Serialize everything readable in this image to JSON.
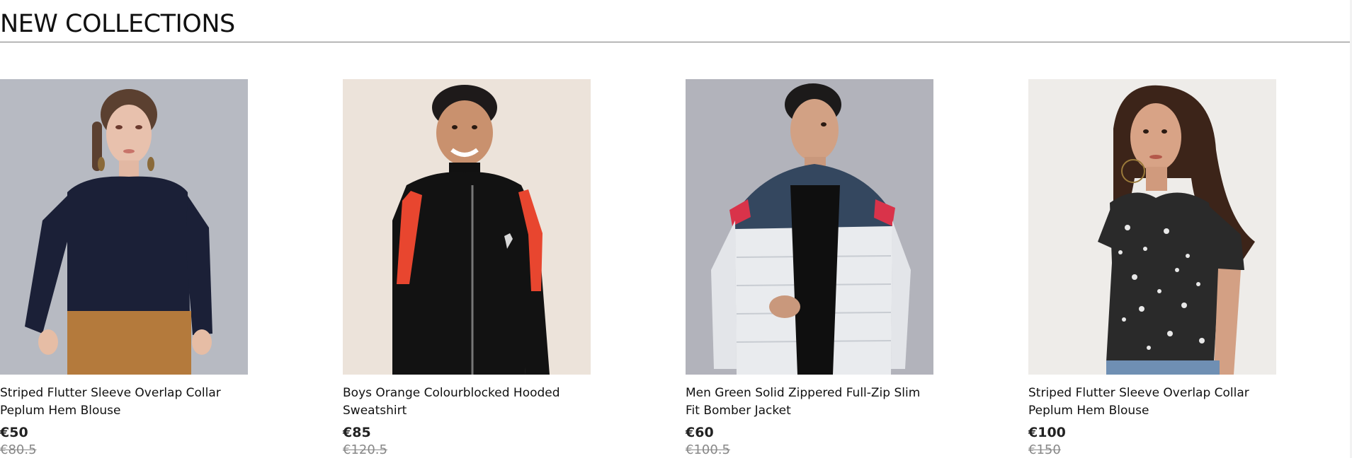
{
  "section": {
    "title": "NEW COLLECTIONS"
  },
  "products": [
    {
      "name": "Striped Flutter Sleeve Overlap Collar Peplum Hem Blouse",
      "price": "€50",
      "old_price": "€80.5",
      "image_bg": "#b7bac2",
      "image_icon": "woman-navy-sweater-photo"
    },
    {
      "name": "Boys Orange Colourblocked Hooded Sweatshirt",
      "price": "€85",
      "old_price": "€120.5",
      "image_bg": "#ece3da",
      "image_icon": "boy-black-track-jacket-photo"
    },
    {
      "name": "Men Green Solid Zippered Full-Zip Slim Fit Bomber Jacket",
      "price": "€60",
      "old_price": "€100.5",
      "image_bg": "#b2b3bb",
      "image_icon": "man-white-puffer-jacket-photo"
    },
    {
      "name": "Striped Flutter Sleeve Overlap Collar Peplum Hem Blouse",
      "price": "€100",
      "old_price": "€150",
      "image_bg": "#eeece9",
      "image_icon": "woman-floral-blouse-photo"
    }
  ]
}
